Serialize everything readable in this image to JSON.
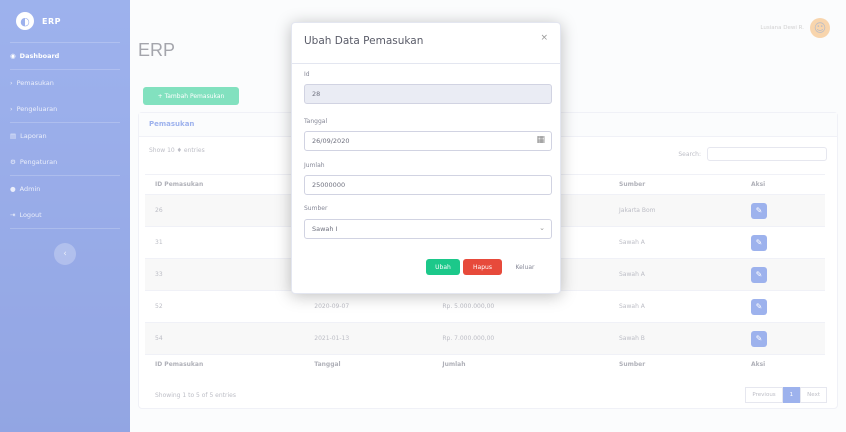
{
  "sidebar": {
    "brand": "ERP",
    "items": [
      {
        "label": "Dashboard",
        "active": true,
        "icon": "tachometer-icon"
      },
      {
        "label": "Pemasukan",
        "icon": "arrow-in-icon"
      },
      {
        "label": "Pengeluaran",
        "icon": "arrow-out-icon"
      },
      {
        "label": "Laporan",
        "icon": "chart-icon"
      },
      {
        "label": "Pengaturan",
        "icon": "gear-icon"
      },
      {
        "label": "Admin",
        "icon": "user-icon"
      },
      {
        "label": "Logout",
        "icon": "logout-icon"
      }
    ]
  },
  "header": {
    "title": "ERP",
    "username": "Lusiana Dewi R."
  },
  "main": {
    "add_button": "+ Tambah Pemasukan",
    "card_title": "Pemasukan",
    "show_entries": "Show 10 ♦ entries",
    "search_label": "Search:",
    "columns": [
      "ID Pemasukan",
      "Tanggal",
      "Jumlah",
      "Sumber",
      "Aksi"
    ],
    "rows": [
      {
        "id": "26",
        "tanggal": "2020-09-26",
        "jumlah": "Rp. 25.000.000,00",
        "sumber": "Jakarta Bom"
      },
      {
        "id": "31",
        "tanggal": "2020-10-01",
        "jumlah": "Rp. 1.000.000,00",
        "sumber": "Sawah A"
      },
      {
        "id": "33",
        "tanggal": "2020-10-05",
        "jumlah": "Rp. 2.000.000,00",
        "sumber": "Sawah A"
      },
      {
        "id": "52",
        "tanggal": "2020-09-07",
        "jumlah": "Rp. 5.000.000,00",
        "sumber": "Sawah A"
      },
      {
        "id": "54",
        "tanggal": "2021-01-13",
        "jumlah": "Rp. 7.000.000,00",
        "sumber": "Sawah B"
      }
    ],
    "info": "Showing 1 to 5 of 5 entries",
    "pagination": {
      "prev": "Previous",
      "current": "1",
      "next": "Next"
    }
  },
  "modal": {
    "title": "Ubah Data Pemasukan",
    "close": "×",
    "id_label": "Id",
    "id_value": "28",
    "tanggal_label": "Tanggal",
    "tanggal_value": "26/09/2020",
    "jumlah_label": "Jumlah",
    "jumlah_value": "25000000",
    "sumber_label": "Sumber",
    "sumber_value": "Sawah I",
    "ubah": "Ubah",
    "hapus": "Hapus",
    "keluar": "Keluar"
  }
}
